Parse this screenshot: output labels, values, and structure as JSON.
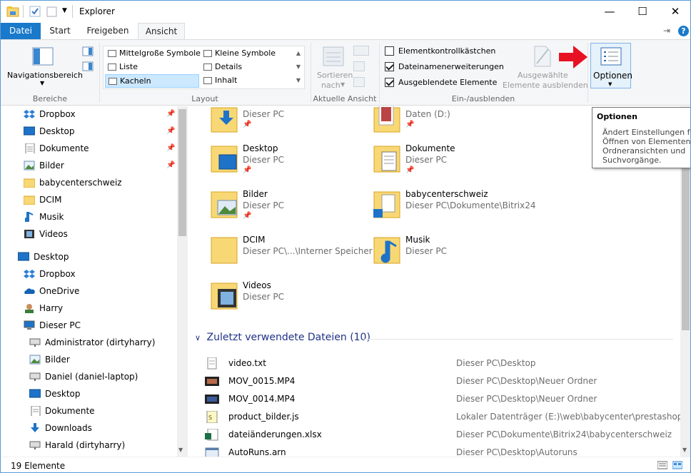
{
  "window": {
    "title": "Explorer"
  },
  "tabs": [
    {
      "label": "Datei"
    },
    {
      "label": "Start"
    },
    {
      "label": "Freigeben"
    },
    {
      "label": "Ansicht"
    }
  ],
  "ribbon": {
    "bereiche": {
      "nav_label": "Navigationsbereich",
      "group": "Bereiche"
    },
    "layout": {
      "group": "Layout",
      "items": [
        "Mittelgroße Symbole",
        "Kleine Symbole",
        "Liste",
        "Details",
        "Kacheln",
        "Inhalt"
      ],
      "selected": "Kacheln"
    },
    "aktuelle_ansicht": {
      "sort_label_1": "Sortieren",
      "sort_label_2": "nach",
      "group": "Aktuelle Ansicht"
    },
    "einausblenden": {
      "group": "Ein-/ausblenden",
      "checkboxes": [
        {
          "label": "Elementkontrollkästchen",
          "checked": false
        },
        {
          "label": "Dateinamenerweiterungen",
          "checked": true
        },
        {
          "label": "Ausgeblendete Elemente",
          "checked": true
        }
      ],
      "hide_selected_1": "Ausgewählte",
      "hide_selected_2": "Elemente ausblenden"
    },
    "optionen": {
      "label": "Optionen"
    }
  },
  "tooltip": {
    "title": "Optionen",
    "lines": [
      "Ändert Einstellungen für",
      "Öffnen von Elementen, D",
      "Ordneransichten und",
      "Suchvorgänge."
    ]
  },
  "nav": {
    "items": [
      {
        "label": "Dropbox",
        "icon": "dropbox-icon",
        "pinned": true
      },
      {
        "label": "Desktop",
        "icon": "desktop-icon",
        "pinned": true
      },
      {
        "label": "Dokumente",
        "icon": "documents-icon",
        "pinned": true
      },
      {
        "label": "Bilder",
        "icon": "pictures-icon",
        "pinned": true
      },
      {
        "label": "babycenterschweiz",
        "icon": "folder-icon",
        "pinned": false
      },
      {
        "label": "DCIM",
        "icon": "folder-icon",
        "pinned": false
      },
      {
        "label": "Musik",
        "icon": "music-icon",
        "pinned": false
      },
      {
        "label": "Videos",
        "icon": "videos-icon",
        "pinned": false
      },
      {
        "label": "Desktop",
        "icon": "desktop-icon",
        "pinned": false
      },
      {
        "label": "Dropbox",
        "icon": "dropbox-icon",
        "pinned": false
      },
      {
        "label": "OneDrive",
        "icon": "onedrive-icon",
        "pinned": false
      },
      {
        "label": "Harry",
        "icon": "user-icon",
        "pinned": false
      },
      {
        "label": "Dieser PC",
        "icon": "pc-icon",
        "pinned": false
      },
      {
        "label": "Administrator (dirtyharry)",
        "icon": "network-drive-icon",
        "pinned": false
      },
      {
        "label": "Bilder",
        "icon": "pictures-icon",
        "pinned": false
      },
      {
        "label": "Daniel (daniel-laptop)",
        "icon": "network-drive-icon",
        "pinned": false
      },
      {
        "label": "Desktop",
        "icon": "desktop-icon",
        "pinned": false
      },
      {
        "label": "Dokumente",
        "icon": "documents-icon",
        "pinned": false
      },
      {
        "label": "Downloads",
        "icon": "downloads-icon",
        "pinned": false
      },
      {
        "label": "Harald (dirtyharry)",
        "icon": "network-drive-icon",
        "pinned": false
      }
    ]
  },
  "quick_access": [
    {
      "name": "",
      "sub": "Dieser PC",
      "icon": "downloads-folder-icon"
    },
    {
      "name": "",
      "sub": "Daten (D:)",
      "icon": "photo-folder-icon"
    },
    {
      "name": "Desktop",
      "sub": "Dieser PC",
      "icon": "desktop-folder-icon"
    },
    {
      "name": "Dokumente",
      "sub": "Dieser PC",
      "icon": "documents-folder-icon"
    },
    {
      "name": "Bilder",
      "sub": "Dieser PC",
      "icon": "pictures-folder-icon"
    },
    {
      "name": "babycenterschweiz",
      "sub": "Dieser PC\\Dokumente\\Bitrix24",
      "icon": "shared-folder-icon"
    },
    {
      "name": "DCIM",
      "sub": "Dieser PC\\...\\Interner Speicher",
      "icon": "folder-icon"
    },
    {
      "name": "Musik",
      "sub": "Dieser PC",
      "icon": "music-folder-icon"
    },
    {
      "name": "Videos",
      "sub": "Dieser PC",
      "icon": "videos-folder-icon"
    }
  ],
  "recent": {
    "header": "Zuletzt verwendete Dateien (10)",
    "files": [
      {
        "name": "video.txt",
        "path": "Dieser PC\\Desktop",
        "icon": "text-file-icon"
      },
      {
        "name": "MOV_0015.MP4",
        "path": "Dieser PC\\Desktop\\Neuer Ordner",
        "icon": "video-file-icon"
      },
      {
        "name": "MOV_0014.MP4",
        "path": "Dieser PC\\Desktop\\Neuer Ordner",
        "icon": "video-file-icon"
      },
      {
        "name": "product_bilder.js",
        "path": "Lokaler Datenträger (E:)\\web\\babycenter\\prestashop\\...\\js",
        "icon": "js-file-icon"
      },
      {
        "name": "dateiänderungen.xlsx",
        "path": "Dieser PC\\Dokumente\\Bitrix24\\babycenterschweiz",
        "icon": "excel-file-icon"
      },
      {
        "name": "AutoRuns.arn",
        "path": "Dieser PC\\Desktop\\Autoruns",
        "icon": "arn-file-icon"
      }
    ]
  },
  "status": {
    "count": "19 Elemente"
  },
  "colors": {
    "accent": "#1979ca",
    "selection": "#cce8ff",
    "arrow": "#e81123",
    "folder": "#f8d775"
  }
}
